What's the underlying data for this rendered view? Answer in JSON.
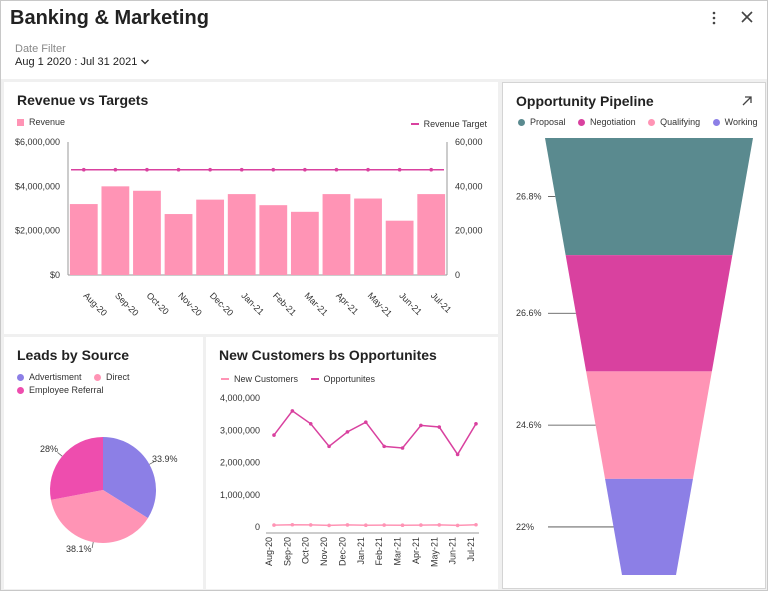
{
  "header": {
    "title": "Banking & Marketing",
    "filter_label": "Date Filter",
    "filter_value": "Aug 1 2020 : Jul 31 2021"
  },
  "colors": {
    "pink": "#ff94b5",
    "magenta": "#d9419f",
    "teal": "#5a8a8f",
    "purple": "#8c7fe6",
    "pie_magenta": "#ee4dae"
  },
  "chart_data": [
    {
      "type": "bar",
      "title": "Revenue vs Targets",
      "categories": [
        "Aug-20",
        "Sep-20",
        "Oct-20",
        "Nov-20",
        "Dec-20",
        "Jan-21",
        "Feb-21",
        "Mar-21",
        "Apr-21",
        "May-21",
        "Jun-21",
        "Jul-21"
      ],
      "series": [
        {
          "name": "Revenue",
          "axis": "left",
          "values": [
            3200000,
            4000000,
            3800000,
            2750000,
            3400000,
            3650000,
            3150000,
            2850000,
            3650000,
            3450000,
            2450000,
            3650000
          ]
        },
        {
          "name": "Revenue Target",
          "axis": "right",
          "type": "line",
          "values": [
            47500,
            47500,
            47500,
            47500,
            47500,
            47500,
            47500,
            47500,
            47500,
            47500,
            47500,
            47500
          ]
        }
      ],
      "y_left_ticks": [
        "$6,000,000",
        "$4,000,000",
        "$2,000,000",
        "$0"
      ],
      "y_right_ticks": [
        "60,000",
        "40,000",
        "20,000",
        "0"
      ],
      "ylim_left": [
        0,
        6000000
      ],
      "ylim_right": [
        0,
        60000
      ],
      "legend_position": "top"
    },
    {
      "type": "pie",
      "title": "Leads by Source",
      "labels": [
        "Advertisment",
        "Direct",
        "Employee Referral"
      ],
      "values": [
        33.9,
        38.1,
        28
      ],
      "value_labels": [
        "33.9%",
        "38.1%",
        "28%"
      ],
      "colors": [
        "#8c7fe6",
        "#ff94b5",
        "#ee4dae"
      ],
      "legend_position": "top-left"
    },
    {
      "type": "line",
      "title": "New Customers bs Opportunites",
      "categories": [
        "Aug-20",
        "Sep-20",
        "Oct-20",
        "Nov-20",
        "Dec-20",
        "Jan-21",
        "Feb-21",
        "Mar-21",
        "Apr-21",
        "May-21",
        "Jun-21",
        "Jul-21"
      ],
      "series": [
        {
          "name": "New Customers",
          "values": [
            60000,
            70000,
            65000,
            50000,
            65000,
            55000,
            60000,
            55000,
            60000,
            65000,
            50000,
            70000
          ]
        },
        {
          "name": "Opportunites",
          "values": [
            2850000,
            3600000,
            3200000,
            2500000,
            2950000,
            3250000,
            2500000,
            2450000,
            3150000,
            3100000,
            2250000,
            3200000
          ]
        }
      ],
      "y_ticks": [
        "4,000,000",
        "3,000,000",
        "2,000,000",
        "1,000,000",
        "0"
      ],
      "ylim": [
        0,
        4000000
      ],
      "legend_position": "top"
    },
    {
      "type": "funnel",
      "title": "Opportunity Pipeline",
      "labels": [
        "Proposal",
        "Negotiation",
        "Qualifying",
        "Working"
      ],
      "values": [
        26.8,
        26.6,
        24.6,
        22
      ],
      "value_labels": [
        "26.8%",
        "26.6%",
        "24.6%",
        "22%"
      ],
      "colors": [
        "#5a8a8f",
        "#d9419f",
        "#ff94b5",
        "#8c7fe6"
      ],
      "legend_position": "top"
    }
  ]
}
